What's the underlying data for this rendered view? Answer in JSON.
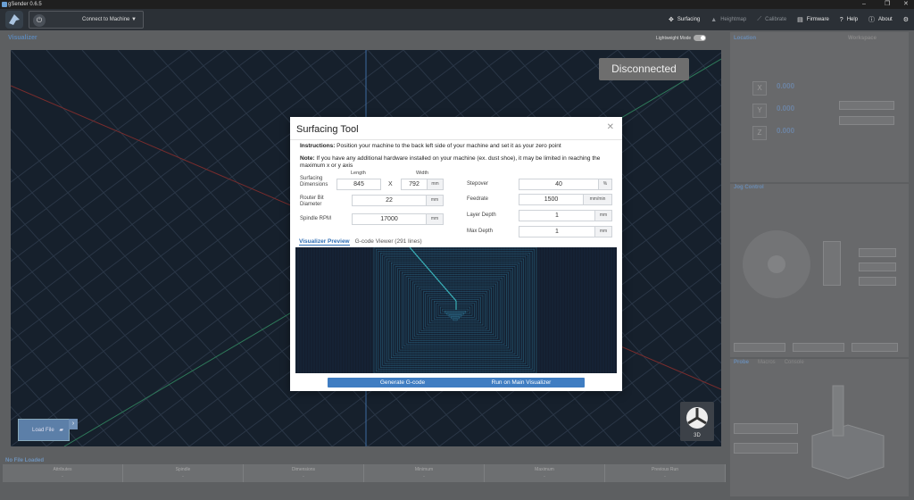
{
  "titlebar": {
    "title": "gSender 0.6.5"
  },
  "window_controls": [
    "–",
    "❐",
    "✕"
  ],
  "nav": {
    "connect_label": "Connect to Machine ▼",
    "links": [
      {
        "label": "Surfacing",
        "icon": "✥",
        "dim": false
      },
      {
        "label": "Heightmap",
        "icon": "▲",
        "dim": true
      },
      {
        "label": "Calibrate",
        "icon": "⟋",
        "dim": true
      },
      {
        "label": "Firmware",
        "icon": "▤",
        "dim": false
      },
      {
        "label": "Help",
        "icon": "?",
        "dim": false
      },
      {
        "label": "About",
        "icon": "ⓘ",
        "dim": false
      },
      {
        "label": "",
        "icon": "⚙",
        "dim": false
      }
    ]
  },
  "visualizer": {
    "label": "Visualizer",
    "lightweight_mode": "Lightweight Mode",
    "status": "Disconnected",
    "load_file": "Load File",
    "view3d": "3D"
  },
  "file_info": {
    "title": "No File Loaded",
    "columns": [
      {
        "label": "Attributes",
        "value": "-"
      },
      {
        "label": "Spindle",
        "value": "-"
      },
      {
        "label": "Dimensions",
        "value": "-"
      },
      {
        "label": "Minimum",
        "value": "-"
      },
      {
        "label": "Maximum",
        "value": "-"
      },
      {
        "label": "Previous Run",
        "value": "-"
      }
    ]
  },
  "right_panel": {
    "location_title": "Location",
    "workspace_label": "Workspace",
    "axes": [
      {
        "axis": "X",
        "value": "0.000"
      },
      {
        "axis": "Y",
        "value": "0.000"
      },
      {
        "axis": "Z",
        "value": "0.000"
      }
    ],
    "jog_title": "Jog Control",
    "probe_tabs": [
      "Probe",
      "Macros",
      "Console"
    ]
  },
  "modal": {
    "title": "Surfacing Tool",
    "instructions_label": "Instructions:",
    "instructions_text": " Position your machine to the back left side of your machine and set it as your zero point",
    "note_label": "Note:",
    "note_text": " If you have any additional hardware installed on your machine (ex. dust shoe), it may be limited in reaching the maximum x or y axis",
    "length_label": "Length",
    "width_label": "Width",
    "surfacing_label": "Surfacing Dimensions",
    "length_value": "845",
    "x_sep": "X",
    "width_value": "792",
    "dim_unit": "mm",
    "router_bit_label": "Router Bit Diameter",
    "router_bit_value": "22",
    "router_bit_unit": "mm",
    "spindle_label": "Spindle RPM",
    "spindle_value": "17000",
    "spindle_unit": "mm",
    "stepover_label": "Stepover",
    "stepover_value": "40",
    "stepover_unit": "%",
    "feedrate_label": "Feedrate",
    "feedrate_value": "1500",
    "feedrate_unit": "mm/min",
    "layer_depth_label": "Layer Depth",
    "layer_depth_value": "1",
    "layer_depth_unit": "mm",
    "max_depth_label": "Max Depth",
    "max_depth_value": "1",
    "max_depth_unit": "mm",
    "tab_preview": "Visualizer Preview",
    "tab_gcode": "G-code Viewer (291 lines)",
    "generate_btn": "Generate G-code",
    "run_btn": "Run on Main Visualizer"
  },
  "colors": {
    "accent": "#3f7dc2",
    "grid_label": "#c0392b",
    "preview_line": "#3aa0c8"
  }
}
